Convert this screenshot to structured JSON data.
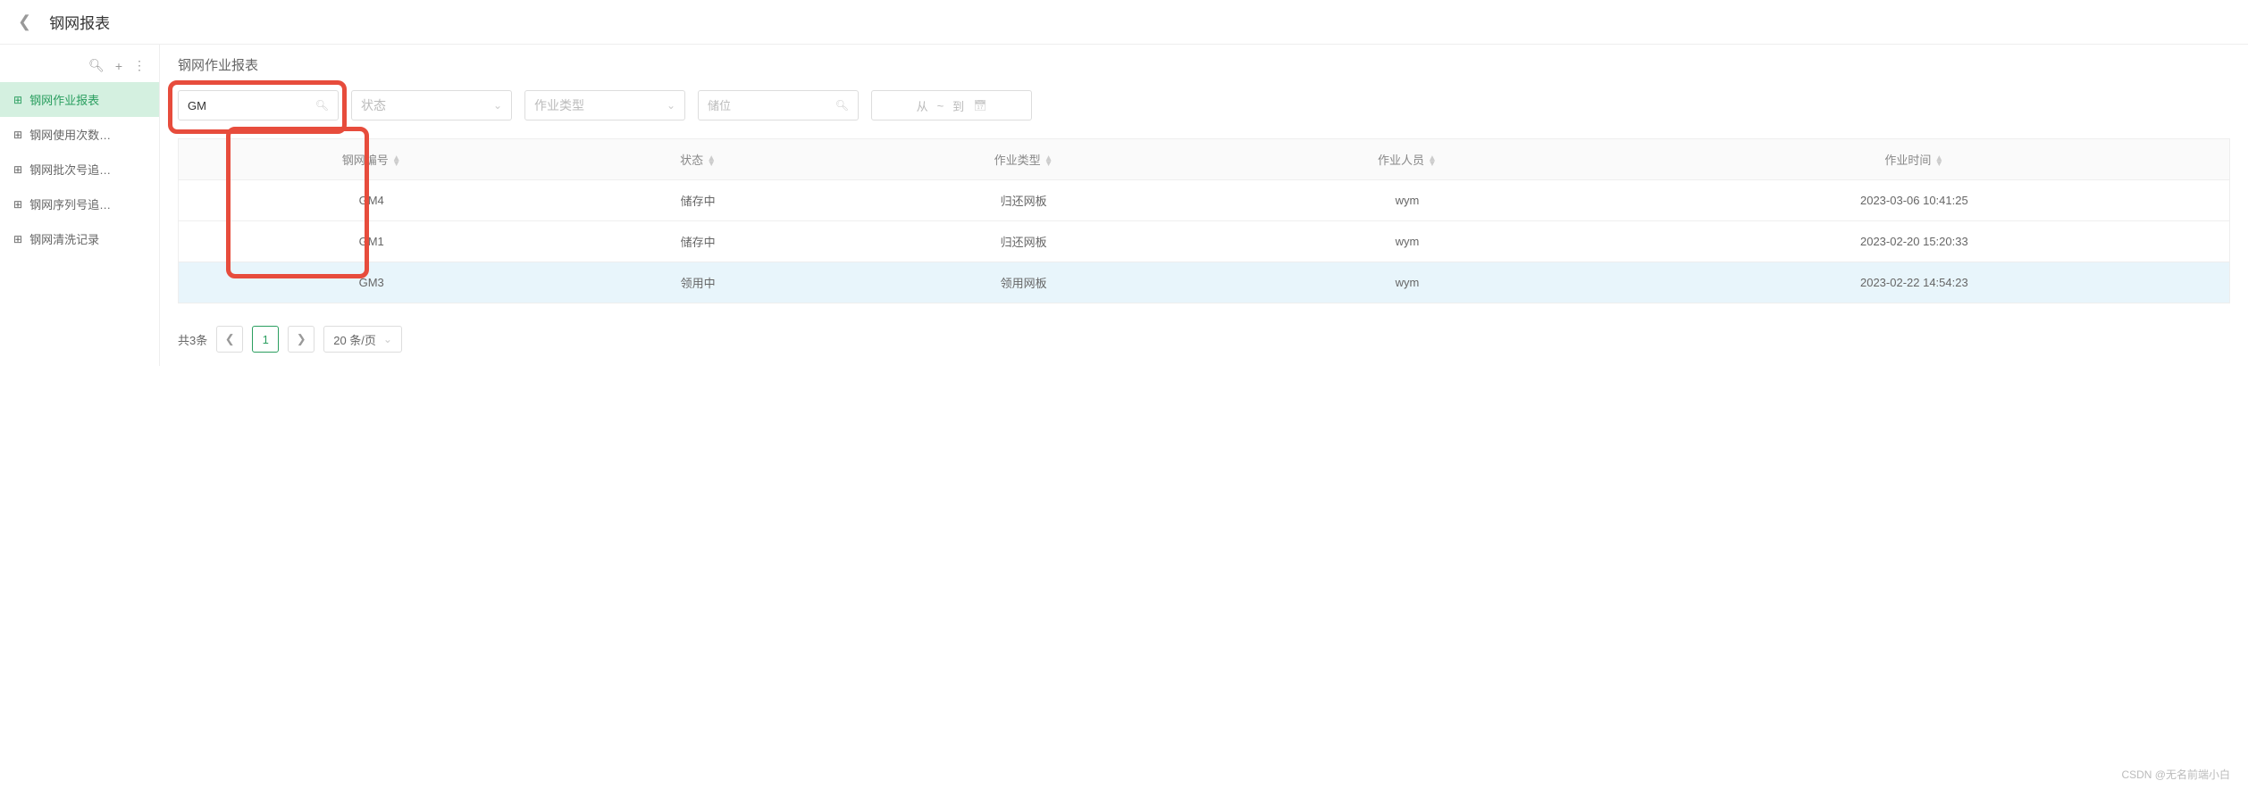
{
  "header": {
    "title": "钢网报表"
  },
  "sidebar": {
    "items": [
      {
        "label": "钢网作业报表",
        "active": true
      },
      {
        "label": "钢网使用次数…",
        "active": false
      },
      {
        "label": "钢网批次号追…",
        "active": false
      },
      {
        "label": "钢网序列号追…",
        "active": false
      },
      {
        "label": "钢网清洗记录",
        "active": false
      }
    ]
  },
  "content": {
    "title": "钢网作业报表",
    "filters": {
      "search_value": "GM",
      "status_placeholder": "状态",
      "type_placeholder": "作业类型",
      "location_placeholder": "储位",
      "date_from": "从",
      "date_sep": "~",
      "date_to": "到"
    },
    "table": {
      "columns": [
        "钢网编号",
        "状态",
        "作业类型",
        "作业人员",
        "作业时间"
      ],
      "rows": [
        {
          "id": "GM4",
          "status": "储存中",
          "type": "归还网板",
          "user": "wym",
          "time": "2023-03-06 10:41:25",
          "active": false
        },
        {
          "id": "GM1",
          "status": "储存中",
          "type": "归还网板",
          "user": "wym",
          "time": "2023-02-20 15:20:33",
          "active": false
        },
        {
          "id": "GM3",
          "status": "领用中",
          "type": "领用网板",
          "user": "wym",
          "time": "2023-02-22 14:54:23",
          "active": true
        }
      ]
    },
    "pagination": {
      "total": "共3条",
      "current": "1",
      "page_size": "20 条/页"
    }
  },
  "watermark": "CSDN @无名前端小白",
  "colors": {
    "accent": "#2a9e5f",
    "highlight": "#e74c3c"
  }
}
